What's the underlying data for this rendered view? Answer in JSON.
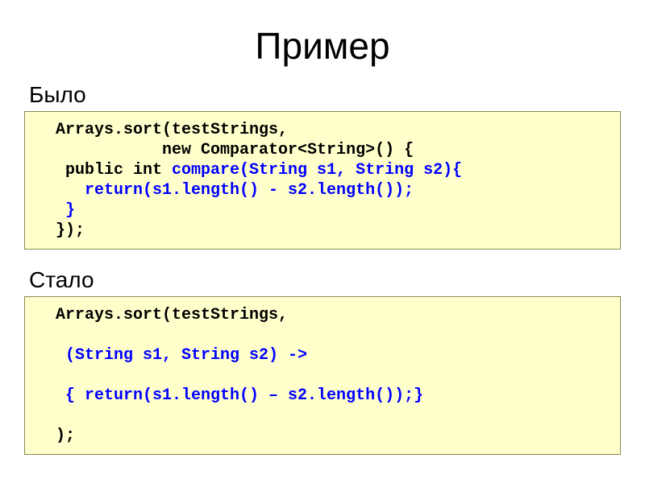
{
  "title": "Пример",
  "section1": {
    "label": "Было",
    "code": {
      "l1": "  Arrays.sort(testStrings, ",
      "l2": "             new Comparator<String>() {",
      "l3a": "   public int ",
      "l3b": "compare(String s1, String s2){",
      "l4a": "     return(s1.length() - s2.length());",
      "l5a": "   }",
      "l6": "  });"
    }
  },
  "section2": {
    "label": "Стало",
    "code": {
      "l1": "  Arrays.sort(testStrings,",
      "l2": "   (String s1, String s2) -> ",
      "l3": "   { return(s1.length() – s2.length());}",
      "l4": "  );"
    }
  }
}
